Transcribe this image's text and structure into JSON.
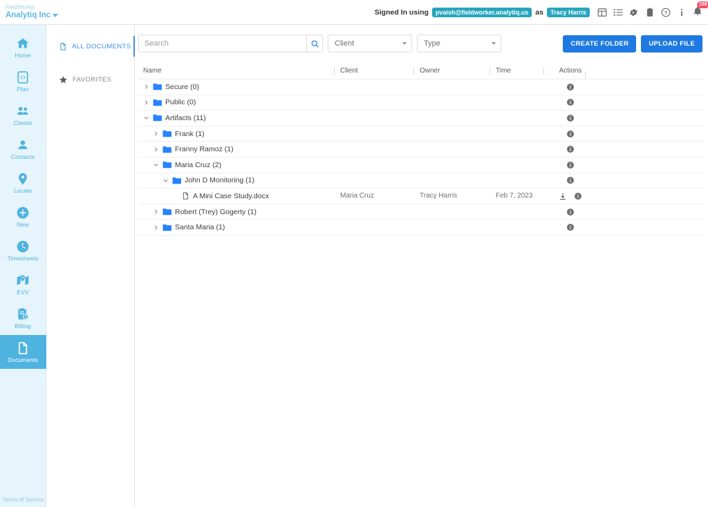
{
  "topbar": {
    "brand_small": "FieldWorker",
    "brand_main": "Analytiq Inc",
    "signed_in_label": "Signed In using",
    "account_email": "pvaish@fieldworker.analytiq.us",
    "as_label": "as",
    "user_name": "Tracy Harris",
    "notification_count": "159",
    "icons": [
      "grid-icon",
      "list-icon",
      "gear-icon",
      "clipboard-icon",
      "help-icon",
      "info-icon",
      "bell-icon"
    ]
  },
  "sidebar": {
    "items": [
      {
        "label": "Home",
        "icon": "home-icon",
        "active": false
      },
      {
        "label": "Plan",
        "icon": "plan-icon",
        "active": false
      },
      {
        "label": "Clients",
        "icon": "clients-icon",
        "active": false
      },
      {
        "label": "Contacts",
        "icon": "contacts-icon",
        "active": false
      },
      {
        "label": "Locate",
        "icon": "locate-icon",
        "active": false
      },
      {
        "label": "New",
        "icon": "new-icon",
        "active": false
      },
      {
        "label": "Timesheets",
        "icon": "clock-icon",
        "active": false
      },
      {
        "label": "EVV",
        "icon": "evv-icon",
        "active": false
      },
      {
        "label": "Billing",
        "icon": "billing-icon",
        "active": false
      },
      {
        "label": "Documents",
        "icon": "document-icon",
        "active": true
      }
    ],
    "terms_of_service": "Terms of Service",
    "accent_color": "#4fb3df",
    "background_color": "#e6f4fb"
  },
  "panel": {
    "items": [
      {
        "label": "ALL DOCUMENTS",
        "icon": "document-icon",
        "active": true
      },
      {
        "label": "FAVORITES",
        "icon": "star-icon",
        "active": false
      }
    ]
  },
  "toolbar": {
    "search_placeholder": "Search",
    "search_value": "",
    "search_icon": "search-icon",
    "client_filter": "Client",
    "type_filter": "Type",
    "create_folder_label": "CREATE FOLDER",
    "upload_file_label": "UPLOAD FILE",
    "button_color": "#1e7ae0"
  },
  "table": {
    "headers": {
      "name": "Name",
      "client": "Client",
      "owner": "Owner",
      "time": "Time",
      "actions": "Actions"
    },
    "rows": [
      {
        "name": "Secure (0)",
        "type": "folder",
        "depth": 0,
        "expanded": false,
        "client": "",
        "owner": "",
        "time": "",
        "download": false
      },
      {
        "name": "Public (0)",
        "type": "folder",
        "depth": 0,
        "expanded": false,
        "client": "",
        "owner": "",
        "time": "",
        "download": false
      },
      {
        "name": "Artifacts (11)",
        "type": "folder",
        "depth": 0,
        "expanded": true,
        "client": "",
        "owner": "",
        "time": "",
        "download": false
      },
      {
        "name": "Frank (1)",
        "type": "folder",
        "depth": 1,
        "expanded": false,
        "client": "",
        "owner": "",
        "time": "",
        "download": false
      },
      {
        "name": "Franny Ramoz (1)",
        "type": "folder",
        "depth": 1,
        "expanded": false,
        "client": "",
        "owner": "",
        "time": "",
        "download": false
      },
      {
        "name": "Maria Cruz (2)",
        "type": "folder",
        "depth": 1,
        "expanded": true,
        "client": "",
        "owner": "",
        "time": "",
        "download": false
      },
      {
        "name": "John D Monitoring (1)",
        "type": "folder",
        "depth": 2,
        "expanded": true,
        "client": "",
        "owner": "",
        "time": "",
        "download": false
      },
      {
        "name": "A Mini Case Study.docx",
        "type": "file",
        "depth": 3,
        "expanded": null,
        "client": "Maria Cruz",
        "owner": "Tracy Harris",
        "time": "Feb 7, 2023",
        "download": true
      },
      {
        "name": "Robert (Trey) Gogerty (1)",
        "type": "folder",
        "depth": 1,
        "expanded": false,
        "client": "",
        "owner": "",
        "time": "",
        "download": false
      },
      {
        "name": "Santa Maria (1)",
        "type": "folder",
        "depth": 1,
        "expanded": false,
        "client": "",
        "owner": "",
        "time": "",
        "download": false
      }
    ],
    "folder_color": "#2684ff",
    "info_icon": "info-icon",
    "download_icon": "download-icon"
  }
}
